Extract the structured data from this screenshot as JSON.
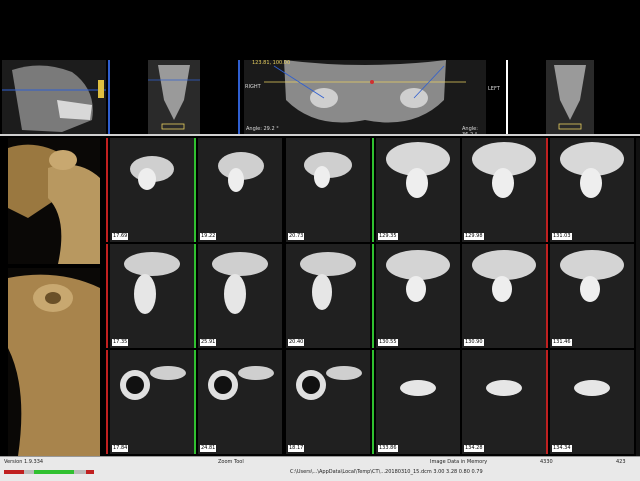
{
  "top": {
    "right_label": "RIGHT",
    "left_label": "LEFT",
    "coord_text": "123.81, 100.00",
    "angle_left": "Angle: 29.2 °",
    "angle_right": "Angle: 36.2 °"
  },
  "slices": {
    "row1": [
      "17.69",
      "19.22",
      "20.73",
      "129.35",
      "129.98",
      "131.03"
    ],
    "row2": [
      "17.35",
      "25.91",
      "20.40",
      "130.55",
      "130.90",
      "131.46"
    ],
    "row3": [
      "17.84",
      "24.81",
      "18.17",
      "133.86",
      "134.28",
      "134.34"
    ]
  },
  "status": {
    "version": "Version 1.9.334",
    "zoom_label": "Zoom Tool",
    "memory_label": "Image Data in Memory",
    "memory_value": "4330",
    "right_value": "423",
    "path": "C:\\Users\\...\\AppData\\Local\\Temp\\CT\\...20180310_15.dcm  3.00  3.28  0.80  0.79"
  },
  "colors": {
    "red_bar": "#c02020",
    "green_bar": "#30c030",
    "accent_blue": "#2f5fd0"
  }
}
